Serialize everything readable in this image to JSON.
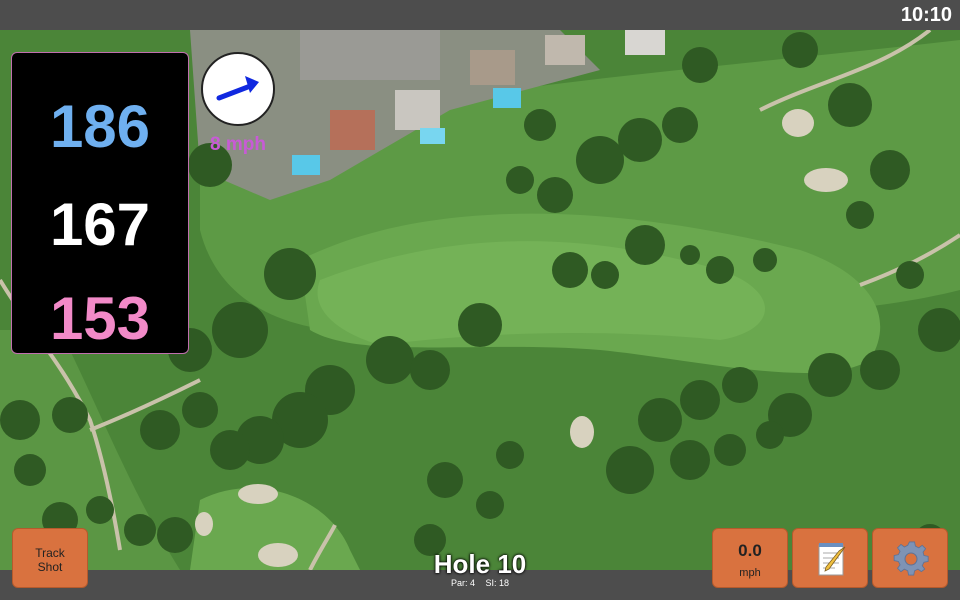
{
  "status_bar": {
    "time": "10:10"
  },
  "yardage": {
    "back": "186",
    "middle": "167",
    "front": "153",
    "colors": {
      "back": "#6fb0f0",
      "middle": "#ffffff",
      "front": "#f28ac8"
    }
  },
  "wind": {
    "speed_label": "8 mph",
    "direction_icon": "arrow-east-northeast",
    "arrow_color": "#1028e0",
    "label_color": "#c85ad6"
  },
  "hole": {
    "title": "Hole 10",
    "par": "Par: 4",
    "stroke_index": "SI: 18"
  },
  "buttons": {
    "track_shot_line1": "Track",
    "track_shot_line2": "Shot",
    "speed_value": "0.0",
    "speed_unit": "mph",
    "notes_icon": "notepad-icon",
    "settings_icon": "gear-icon"
  },
  "map": {
    "view": "satellite"
  }
}
